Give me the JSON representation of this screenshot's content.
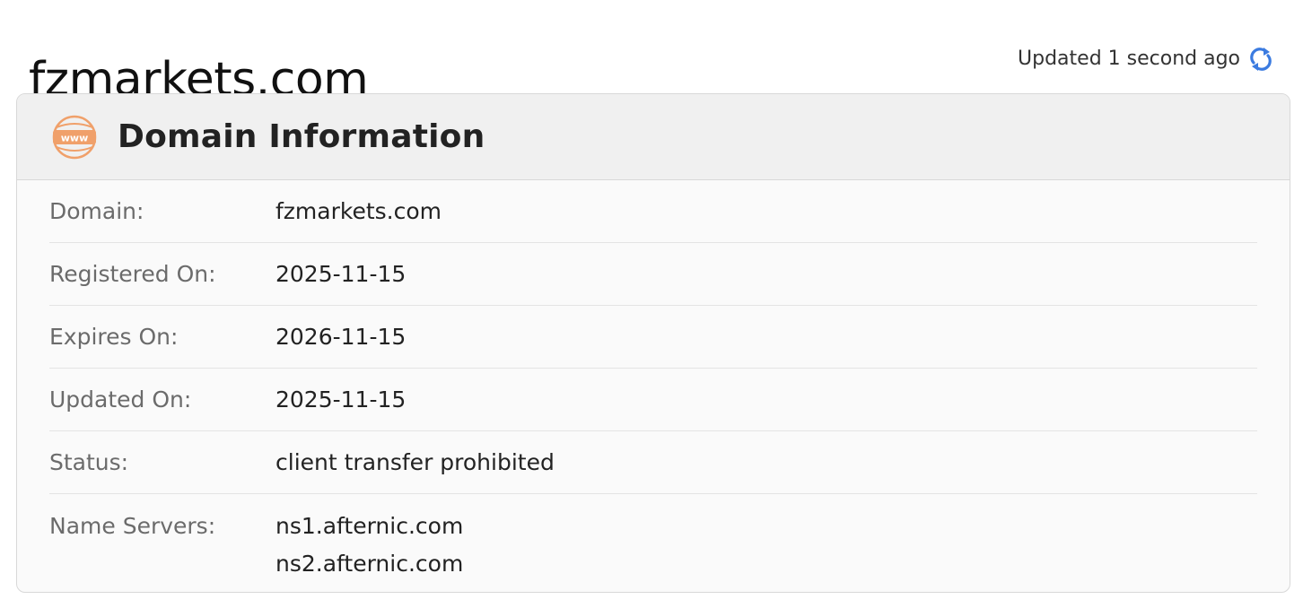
{
  "header": {
    "title": "fzmarkets.com",
    "updated_text": "Updated 1 second ago",
    "refresh_icon": "refresh-icon",
    "refresh_color": "#3b7be0"
  },
  "card": {
    "title": "Domain Information",
    "icon": "www-globe-icon",
    "icon_color": "#f0a06a",
    "rows": [
      {
        "label": "Domain:",
        "value": "fzmarkets.com"
      },
      {
        "label": "Registered On:",
        "value": "2025-11-15"
      },
      {
        "label": "Expires On:",
        "value": "2026-11-15"
      },
      {
        "label": "Updated On:",
        "value": "2025-11-15"
      },
      {
        "label": "Status:",
        "value": "client transfer prohibited"
      },
      {
        "label": "Name Servers:",
        "values": [
          "ns1.afternic.com",
          "ns2.afternic.com"
        ]
      }
    ]
  }
}
